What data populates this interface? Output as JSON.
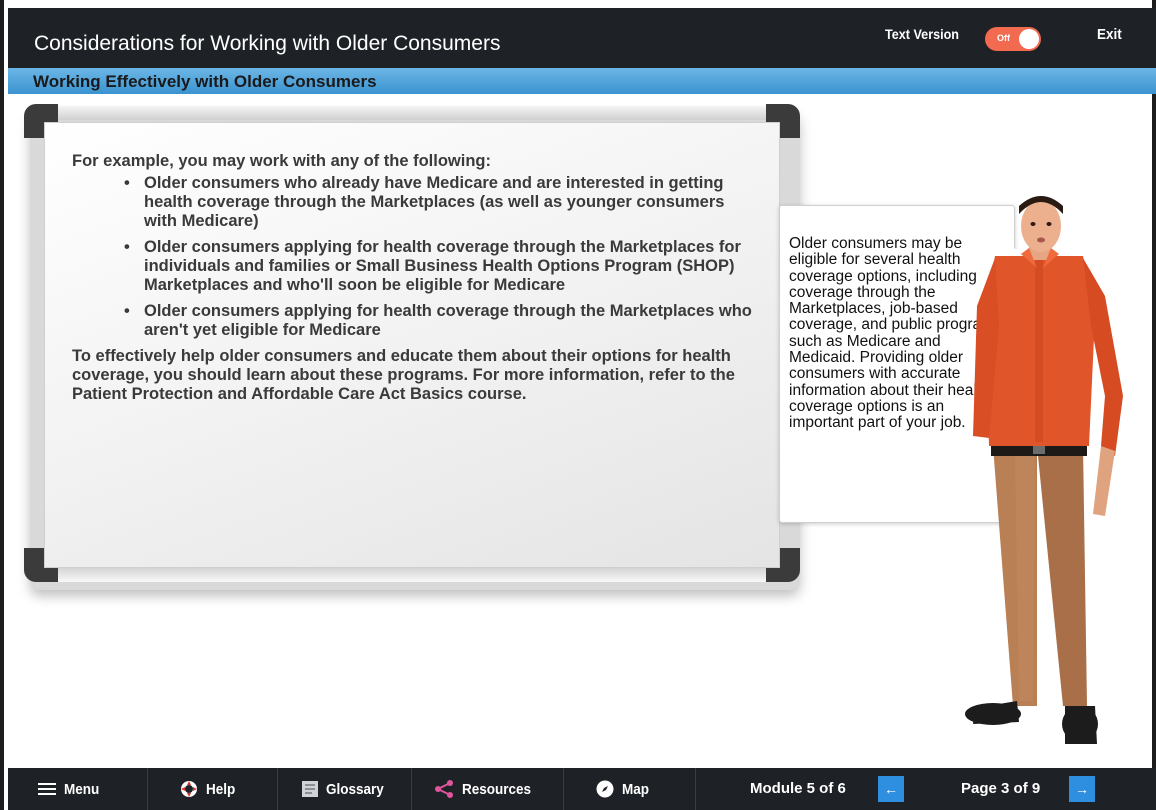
{
  "header": {
    "course_title": "Considerations for Working with Older Consumers",
    "text_version_label": "Text Version",
    "toggle_state": "Off",
    "exit_label": "Exit"
  },
  "section": {
    "title": "Working Effectively with Older Consumers"
  },
  "board": {
    "intro": "For example, you may work with any of the following:",
    "bullets": [
      "Older consumers who already have Medicare and are interested in getting health coverage through the Marketplaces (as well as younger consumers with Medicare)",
      "Older consumers applying for health coverage through the Marketplaces for individuals and families or Small Business Health Options Program (SHOP) Marketplaces and who'll soon be eligible for Medicare",
      "Older consumers applying for health coverage through the Marketplaces who aren't yet eligible for Medicare"
    ],
    "conclusion": "To effectively help older consumers and educate them about their options for health coverage, you should learn about these programs. For more information, refer to the Patient Protection and Affordable Care Act Basics course."
  },
  "bubble": {
    "text": "Older consumers may be eligible for several health coverage options, including coverage through the Marketplaces, job-based coverage, and public programs such as Medicare and Medicaid. Providing older consumers with accurate information about their health coverage options is an important part of your job."
  },
  "footer": {
    "menu": "Menu",
    "help": "Help",
    "glossary": "Glossary",
    "resources": "Resources",
    "map": "Map",
    "module": "Module 5 of 6",
    "prev_arrow": "←",
    "page": "Page 3 of 9",
    "next_arrow": "→"
  },
  "colors": {
    "header_bg": "#1e2226",
    "section_bar": "#3a93d0",
    "toggle_bg": "#f26a4f",
    "arrow_btn": "#2e8fe0"
  }
}
